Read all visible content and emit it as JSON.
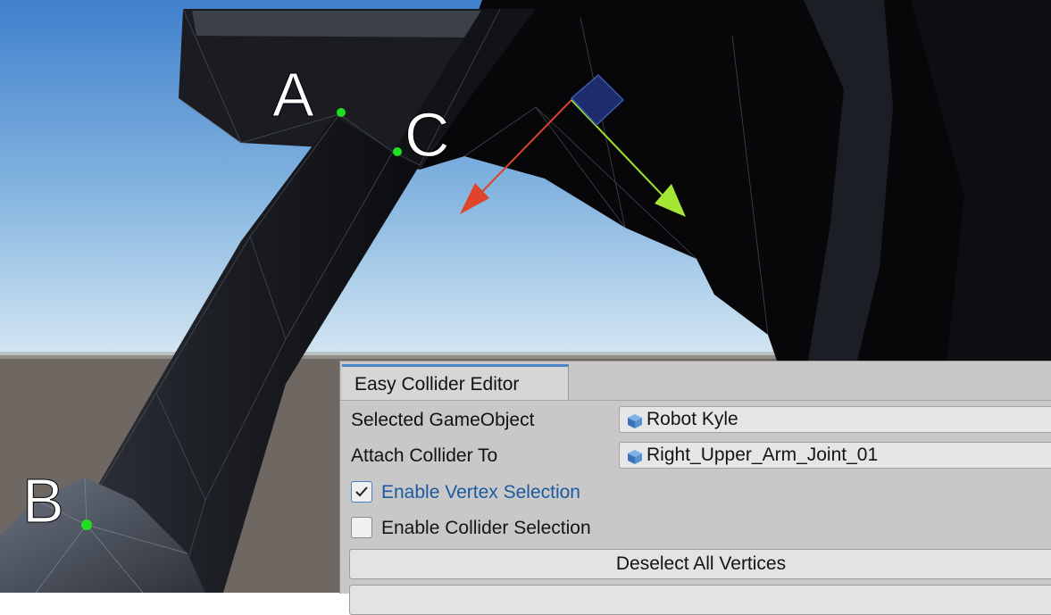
{
  "scene": {
    "vertex_labels": [
      "A",
      "B",
      "C"
    ],
    "colors": {
      "sky_top": "#4b8ad2",
      "sky_bottom": "#c9dff0",
      "ground": "#6e6660",
      "mesh_dark": "#0a0a0d",
      "vertex_marker": "#1fe01f",
      "gizmo_x": "#e0452c",
      "gizmo_y": "#9ee02a",
      "gizmo_box": "#1c2c6c"
    }
  },
  "panel": {
    "tab_title": "Easy Collider Editor",
    "selected_gameobject_label": "Selected GameObject",
    "selected_gameobject_value": "Robot Kyle",
    "attach_collider_label": "Attach Collider To",
    "attach_collider_value": "Right_Upper_Arm_Joint_01",
    "enable_vertex_selection_label": "Enable Vertex Selection",
    "enable_vertex_selection_checked": true,
    "enable_collider_selection_label": "Enable Collider Selection",
    "enable_collider_selection_checked": false,
    "deselect_all_label": "Deselect All Vertices",
    "object_icon": "unity-gameobject-cube-icon",
    "accent_color": "#4a86c8"
  }
}
